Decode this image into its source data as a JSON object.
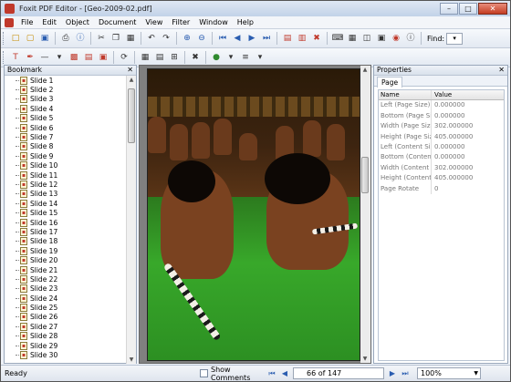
{
  "window": {
    "title": "Foxit PDF Editor - [Geo-2009-02.pdf]"
  },
  "menu": [
    "File",
    "Edit",
    "Object",
    "Document",
    "View",
    "Filter",
    "Window",
    "Help"
  ],
  "toolbar": {
    "find_label": "Find:"
  },
  "bookmark": {
    "title": "Bookmark",
    "items": [
      "Slide 1",
      "Slide 2",
      "Slide 3",
      "Slide 4",
      "Slide 5",
      "Slide 6",
      "Slide 7",
      "Slide 8",
      "Slide 9",
      "Slide 10",
      "Slide 11",
      "Slide 12",
      "Slide 13",
      "Slide 14",
      "Slide 15",
      "Slide 16",
      "Slide 17",
      "Slide 18",
      "Slide 19",
      "Slide 20",
      "Slide 21",
      "Slide 22",
      "Slide 23",
      "Slide 24",
      "Slide 25",
      "Slide 26",
      "Slide 27",
      "Slide 28",
      "Slide 29",
      "Slide 30"
    ]
  },
  "properties": {
    "title": "Properties",
    "tab": "Page",
    "col_name": "Name",
    "col_value": "Value",
    "rows": [
      {
        "name": "Left (Page Size)",
        "value": "0.000000"
      },
      {
        "name": "Bottom (Page Size)",
        "value": "0.000000"
      },
      {
        "name": "Width (Page Size)",
        "value": "302.000000"
      },
      {
        "name": "Height (Page Size)",
        "value": "405.000000"
      },
      {
        "name": "Left (Content Size)",
        "value": "0.000000"
      },
      {
        "name": "Bottom (Content Size)",
        "value": "0.000000"
      },
      {
        "name": "Width (Content Size)",
        "value": "302.000000"
      },
      {
        "name": "Height (Content Size)",
        "value": "405.000000"
      },
      {
        "name": "Page Rotate",
        "value": "0"
      }
    ]
  },
  "status": {
    "ready": "Ready",
    "show_comments": "Show Comments",
    "page": "66 of 147",
    "zoom": "100%"
  }
}
